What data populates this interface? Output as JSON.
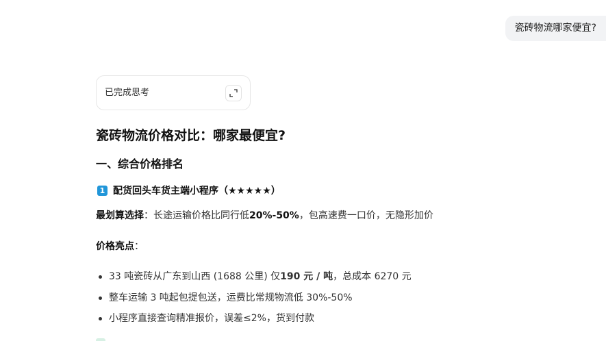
{
  "user_message": "瓷砖物流哪家便宜?",
  "thinking": {
    "label": "已完成思考",
    "expand_icon": "expand-icon"
  },
  "answer": {
    "title": "瓷砖物流价格对比：哪家最便宜?",
    "section_heading": "一、综合价格排名",
    "item": {
      "badge": "1",
      "heading": "配货回头车货主端小程序（★★★★★）"
    },
    "best_choice": {
      "label": "最划算选择",
      "colon": "：",
      "text_before": "长途运输价格比同行低",
      "highlight": "20%-50%",
      "text_after": "，包高速费一口价，无隐形加价"
    },
    "highlights_label": "价格亮点",
    "highlights_colon": "：",
    "bullets": {
      "b1_before": "33 吨瓷砖从广东到山西 (1688 公里) 仅",
      "b1_bold": "190 元 / 吨",
      "b1_after": "，总成本 6270 元",
      "b2": "整车运输 3 吨起包提包送，运费比常规物流低 30%-50%",
      "b3": "小程序直接查询精准报价，误差≤2%，货到付款"
    }
  }
}
